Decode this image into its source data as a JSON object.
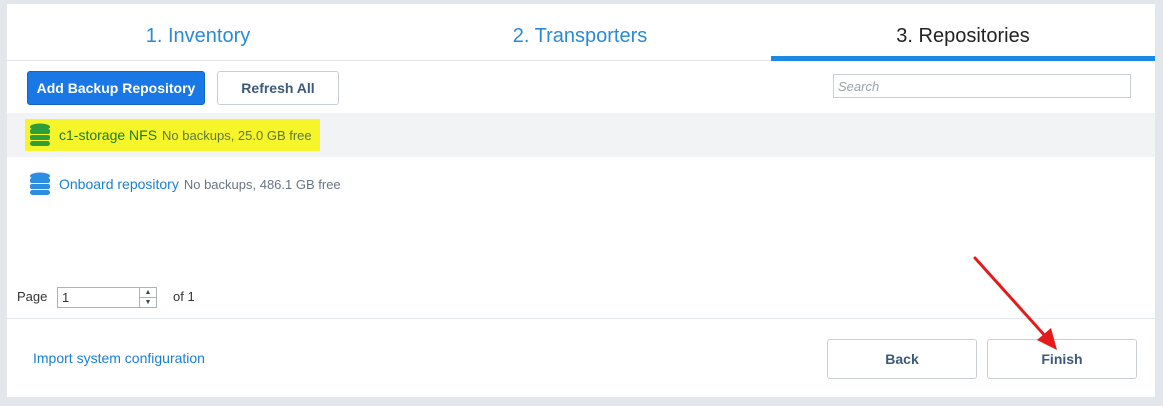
{
  "tabs": [
    {
      "label": "1. Inventory",
      "active": false
    },
    {
      "label": "2. Transporters",
      "active": false
    },
    {
      "label": "3. Repositories",
      "active": true
    }
  ],
  "toolbar": {
    "add_label": "Add Backup Repository",
    "refresh_label": "Refresh All",
    "search_placeholder": "Search"
  },
  "repositories": [
    {
      "name": "c1-storage NFS",
      "status": "No backups, 25.0 GB free",
      "selected": true,
      "icon": "database-icon",
      "color": "#2e9e3a"
    },
    {
      "name": "Onboard repository",
      "status": "No backups, 486.1 GB free",
      "selected": false,
      "icon": "database-icon",
      "color": "#2b8ee0"
    }
  ],
  "pager": {
    "page_label": "Page",
    "page_value": "1",
    "of_label": "of 1"
  },
  "footer": {
    "import_label": "Import system configuration",
    "back_label": "Back",
    "finish_label": "Finish"
  },
  "colors": {
    "accent": "#1e88e5",
    "highlight": "#f5f52a",
    "annotation_arrow": "#e51b1b"
  }
}
